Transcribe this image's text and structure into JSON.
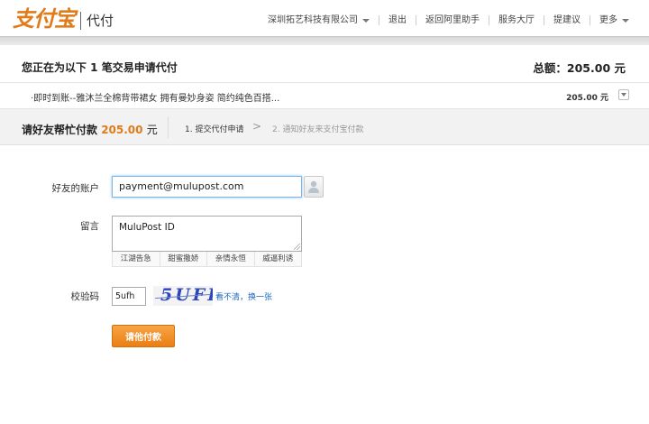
{
  "header": {
    "logo_text": "支付宝",
    "product": "代付",
    "nav": [
      {
        "label": "深圳拓艺科技有限公司",
        "dropdown": true
      },
      {
        "label": "退出",
        "dropdown": false
      },
      {
        "label": "返回阿里助手",
        "dropdown": false
      },
      {
        "label": "服务大厅",
        "dropdown": false
      },
      {
        "label": "提建议",
        "dropdown": false
      },
      {
        "label": "更多",
        "dropdown": true
      }
    ]
  },
  "order": {
    "title": "您正在为以下 1 笔交易申请代付",
    "total": "总额：205.00 元",
    "item_name": "·即时到账--雅沐兰全棉背带裙女 拥有曼妙身姿 简约纯色百搭...",
    "item_amount": "205.00 元"
  },
  "pay": {
    "label": "请好友帮忙付款",
    "amount": "205.00",
    "unit": "元",
    "step1": "1. 提交代付申请",
    "arrow": ">",
    "step2": "2. 通知好友来支付宝付款"
  },
  "form": {
    "account_label": "好友的账户",
    "account_value": "payment@mulupost.com",
    "message_label": "留言",
    "message_value": "MuluPost ID",
    "quick_tags": [
      "江湖告急",
      "甜蜜撒娇",
      "亲情永恒",
      "威逼利诱"
    ],
    "code_label": "校验码",
    "code_value": "5ufh",
    "captcha_text": "5UFH",
    "refresh_label": "看不清，换一张",
    "submit_label": "请他付款"
  },
  "colors": {
    "brand_orange": "#e07b1a",
    "link_blue": "#1a66c2",
    "captcha_blue": "#2a46b8"
  }
}
